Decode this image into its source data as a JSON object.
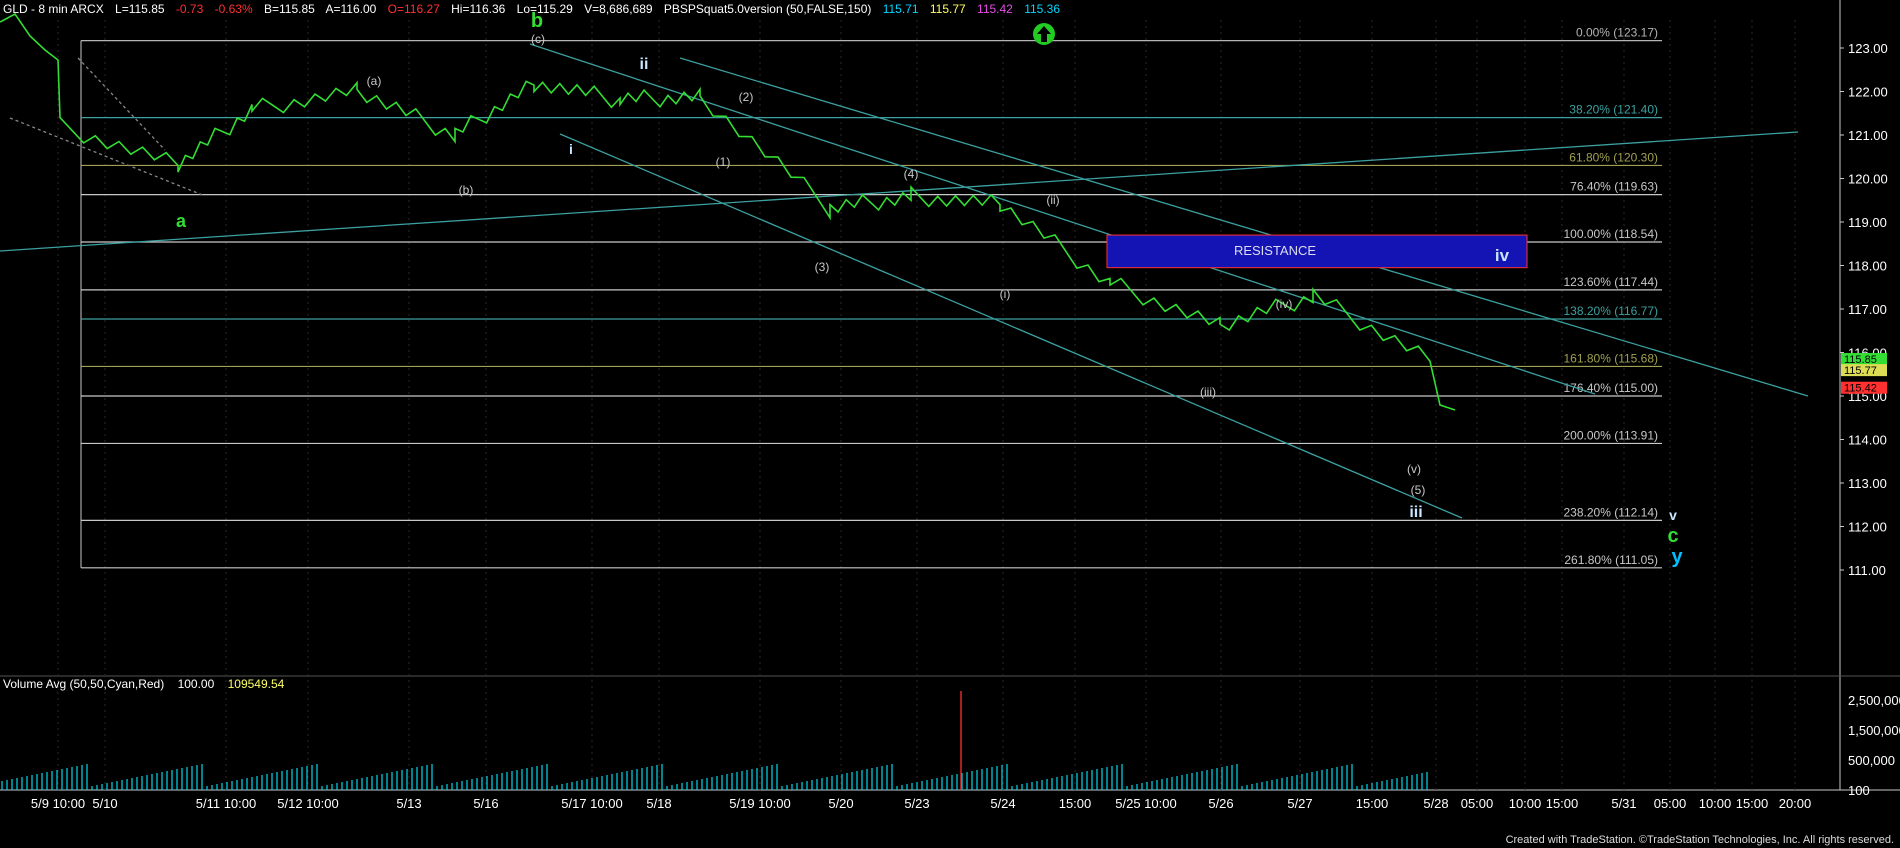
{
  "header": {
    "symbol": "GLD - 8 min  ARCX",
    "last": "L=115.85",
    "change": "-0.73",
    "change_pct": "-0.63%",
    "bid": "B=115.85",
    "ask": "A=116.00",
    "open": "O=116.27",
    "high": "Hi=116.36",
    "low": "Lo=115.29",
    "volume": "V=8,686,689",
    "study": "PBSPSquat5.0version (50,FALSE,150)",
    "study_values": [
      "115.71",
      "115.77",
      "115.42",
      "115.36"
    ],
    "colors": {
      "label": "#ffffff",
      "negative": "#ff3030",
      "study1": "#00d7ff",
      "study2": "#ffff66",
      "study3": "#e64ce6",
      "study4": "#00d7ff"
    }
  },
  "volume_header": {
    "label": "Volume Avg (50,50,Cyan,Red)",
    "value1": "100.00",
    "value2": "109549.54"
  },
  "footer": "Created with TradeStation. ©TradeStation Technologies, Inc. All rights reserved.",
  "chart_data": [
    {
      "type": "line",
      "series": [
        {
          "x": [
            "5/9 10:00",
            "5/10",
            "5/11 10:00",
            "5/12 10:00",
            "5/13",
            "5/16",
            "5/17 10:00",
            "5/18",
            "5/19 10:00",
            "5/20",
            "5/23",
            "5/24",
            "5/25 10:00",
            "5/26",
            "5/27"
          ],
          "y": [
            121.2,
            120.3,
            121.6,
            122.0,
            121.0,
            122.2,
            121.8,
            121.9,
            119.3,
            119.6,
            119.4,
            117.6,
            116.6,
            117.3,
            115.85
          ]
        }
      ],
      "x_tick_labels": [
        "5/9 10:00",
        "5/10",
        "5/11 10:00",
        "5/12 10:00",
        "5/13",
        "5/16",
        "5/17 10:00",
        "5/18",
        "5/19 10:00",
        "5/20",
        "5/23",
        "5/24",
        "15:00",
        "5/25 10:00",
        "5/26",
        "5/27",
        "15:00",
        "5/28",
        "05:00",
        "10:00",
        "15:00",
        "5/31",
        "05:00",
        "10:00",
        "15:00",
        "20:00"
      ],
      "y_tick_labels": [
        "123.00",
        "122.00",
        "121.00",
        "120.00",
        "119.00",
        "118.00",
        "117.00",
        "116.00",
        "115.00",
        "114.00",
        "113.00",
        "112.00",
        "111.00"
      ],
      "ylim": [
        110.8,
        123.6
      ],
      "price_flags": [
        {
          "text": "115.85",
          "color": "#33dd33",
          "value": 115.85
        },
        {
          "text": "115.77",
          "color": "#dddd55",
          "value": 115.71
        },
        {
          "text": "115.42",
          "color": "#ff3030",
          "value": 115.42
        }
      ],
      "fib_levels": [
        {
          "label": "0.00% (123.17)",
          "value": 123.17,
          "color": "#b4b4b4"
        },
        {
          "label": "38.20% (121.40)",
          "value": 121.4,
          "color": "#3ca0a0"
        },
        {
          "label": "61.80% (120.30)",
          "value": 120.3,
          "color": "#a0a050"
        },
        {
          "label": "76.40% (119.63)",
          "value": 119.63,
          "color": "#c8c8c8"
        },
        {
          "label": "100.00% (118.54)",
          "value": 118.54,
          "color": "#c8c8c8"
        },
        {
          "label": "123.60% (117.44)",
          "value": 117.44,
          "color": "#c8c8c8"
        },
        {
          "label": "138.20% (116.77)",
          "value": 116.77,
          "color": "#3ca0a0"
        },
        {
          "label": "161.80% (115.68)",
          "value": 115.68,
          "color": "#a0a050"
        },
        {
          "label": "176.40% (115.00)",
          "value": 115.0,
          "color": "#c8c8c8"
        },
        {
          "label": "200.00% (113.91)",
          "value": 113.91,
          "color": "#c8c8c8"
        },
        {
          "label": "238.20% (112.14)",
          "value": 112.14,
          "color": "#c8c8c8"
        },
        {
          "label": "261.80% (111.05)",
          "value": 111.05,
          "color": "#c8c8c8"
        }
      ],
      "resistance": {
        "label": "RESISTANCE",
        "wave": "iv",
        "top": 118.7,
        "bottom": 117.95
      },
      "wave_labels": [
        {
          "text": "b",
          "color": "#33dd33"
        },
        {
          "text": "a",
          "color": "#33dd33"
        },
        {
          "text": "(c)",
          "color": "#c8c8c8"
        },
        {
          "text": "ii",
          "color": "#c8e6ff"
        },
        {
          "text": "i",
          "color": "#c8e6ff"
        },
        {
          "text": "(a)",
          "color": "#c8c8c8"
        },
        {
          "text": "(b)",
          "color": "#c8c8c8"
        },
        {
          "text": "(2)",
          "color": "#c8c8c8"
        },
        {
          "text": "(1)",
          "color": "#c8c8c8"
        },
        {
          "text": "(4)",
          "color": "#c8c8c8"
        },
        {
          "text": "(3)",
          "color": "#c8c8c8"
        },
        {
          "text": "(ii)",
          "color": "#c8c8c8"
        },
        {
          "text": "(i)",
          "color": "#c8c8c8"
        },
        {
          "text": "(iv)",
          "color": "#c8c8c8"
        },
        {
          "text": "(iii)",
          "color": "#c8c8c8"
        },
        {
          "text": "(v)",
          "color": "#c8c8c8"
        },
        {
          "text": "(5)",
          "color": "#c8c8c8"
        },
        {
          "text": "iii",
          "color": "#c8e6ff"
        },
        {
          "text": "v",
          "color": "#c8e6ff"
        },
        {
          "text": "c",
          "color": "#33dd33"
        },
        {
          "text": "y",
          "color": "#00c0ff"
        }
      ],
      "marker": "up-arrow-icon"
    },
    {
      "type": "bar",
      "title": "Volume Avg (50,50,Cyan,Red)",
      "y_tick_labels": [
        "2,500,000",
        "1,500,000",
        "500,000",
        "100"
      ],
      "ylim": [
        0,
        3000000
      ],
      "peak_value": 2800000
    }
  ]
}
